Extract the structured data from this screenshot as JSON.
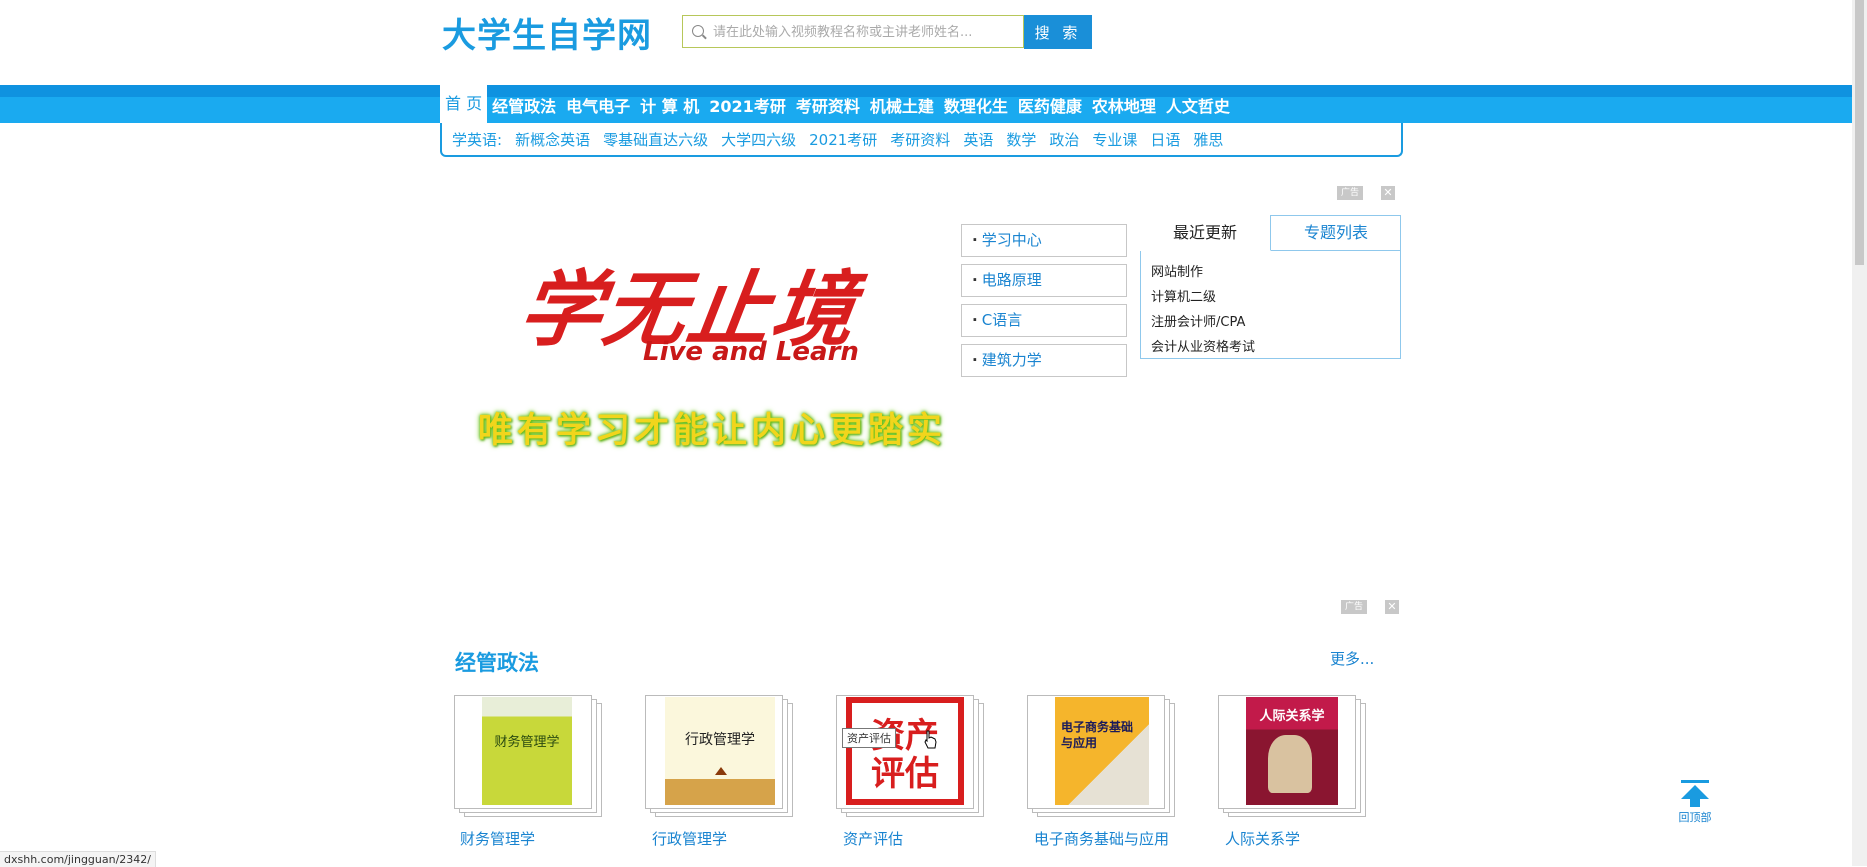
{
  "header": {
    "logo": "大学生自学网",
    "search_placeholder": "请在此处输入视频教程名称或主讲老师姓名...",
    "search_button": "搜 索"
  },
  "nav": {
    "items": [
      "首 页",
      "经管政法",
      "电气电子",
      "计 算 机",
      "2021考研",
      "考研资料",
      "机械土建",
      "数理化生",
      "医药健康",
      "农林地理",
      "人文哲史"
    ],
    "active_index": 0
  },
  "subnav": {
    "label": "学英语:",
    "items": [
      "新概念英语",
      "零基础直达六级",
      "大学四六级",
      "2021考研",
      "考研资料",
      "英语",
      "数学",
      "政治",
      "专业课",
      "日语",
      "雅思"
    ]
  },
  "ad": {
    "badge": "广告",
    "close": "✕"
  },
  "banner": {
    "main": "学无止境",
    "sub": "Live and Learn",
    "motto": "唯有学习才能让内心更踏实"
  },
  "links": [
    "学习中心",
    "电路原理",
    "C语言",
    "建筑力学"
  ],
  "updates": {
    "tab_recent": "最近更新",
    "tab_topics": "专题列表",
    "items": [
      "网站制作",
      "计算机二级",
      "注册会计师/CPA",
      "会计从业资格考试"
    ]
  },
  "section": {
    "title": "经管政法",
    "more": "更多...",
    "books": [
      {
        "title": "财务管理学",
        "cover_text": "财务管理学"
      },
      {
        "title": "行政管理学",
        "cover_text": "行政管理学"
      },
      {
        "title": "资产评估",
        "cover_text": "资产评估"
      },
      {
        "title": "电子商务基础与应用",
        "cover_text": "电子商务基础与应用"
      },
      {
        "title": "人际关系学",
        "cover_text": "人际关系学"
      }
    ],
    "tooltip": "资产评估"
  },
  "back_to_top": "回顶部",
  "status_bar": "dxshh.com/jingguan/2342/",
  "colors": {
    "brand": "#1a9be0",
    "nav": "#1aaaf0",
    "banner_red": "#d81e1e"
  }
}
